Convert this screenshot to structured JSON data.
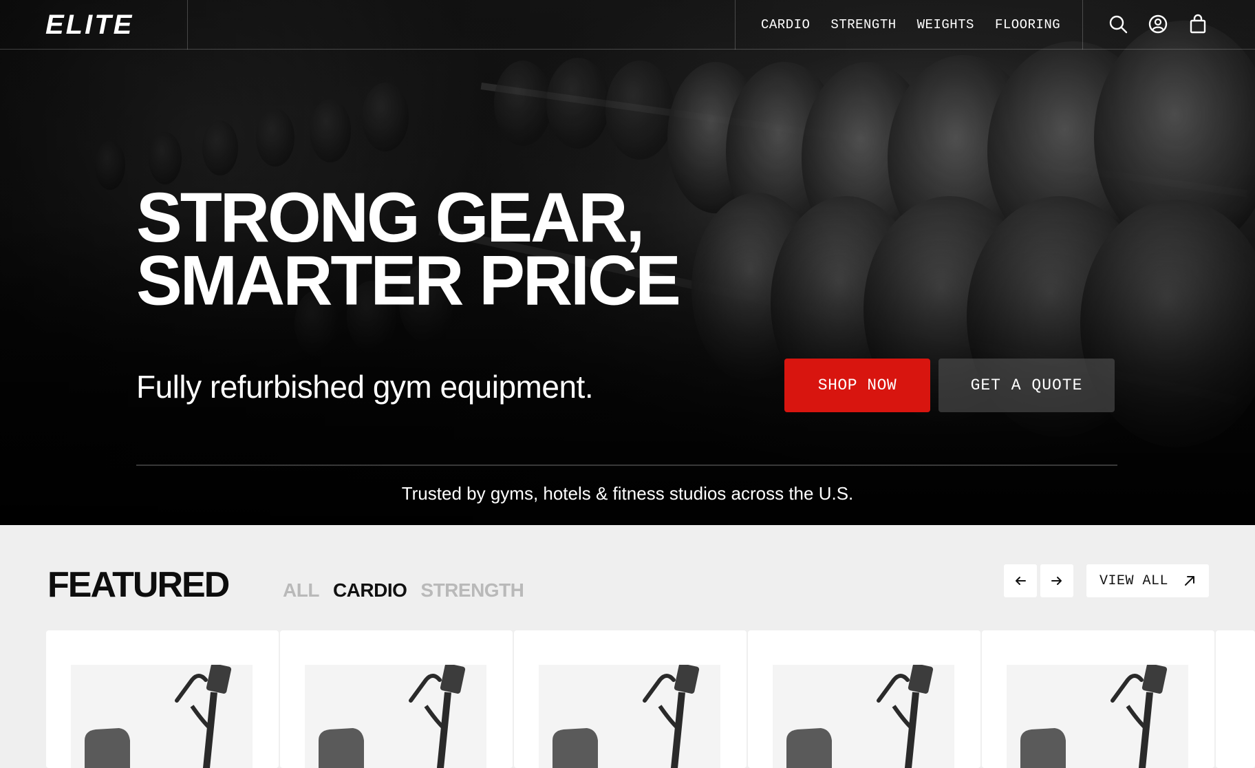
{
  "brand": {
    "name": "ELITE"
  },
  "nav": {
    "items": [
      {
        "label": "CARDIO"
      },
      {
        "label": "STRENGTH"
      },
      {
        "label": "WEIGHTS"
      },
      {
        "label": "FLOORING"
      }
    ],
    "icons": [
      "search-icon",
      "account-icon",
      "bag-icon"
    ]
  },
  "hero": {
    "headline_line1": "STRONG GEAR,",
    "headline_line2": "SMARTER PRICE",
    "subhead": "Fully refurbished gym equipment.",
    "primary_cta": "SHOP NOW",
    "secondary_cta": "GET A QUOTE",
    "trusted": "Trusted by gyms, hotels & fitness studios across the U.S."
  },
  "featured": {
    "title": "FEATURED",
    "tabs": [
      {
        "label": "ALL",
        "active": false
      },
      {
        "label": "CARDIO",
        "active": true
      },
      {
        "label": "STRENGTH",
        "active": false
      }
    ],
    "view_all": "VIEW ALL",
    "product_count_visible": 5
  },
  "colors": {
    "accent": "#d8150f",
    "hero_bg": "#0c0c0c",
    "page_bg": "#efefef"
  }
}
